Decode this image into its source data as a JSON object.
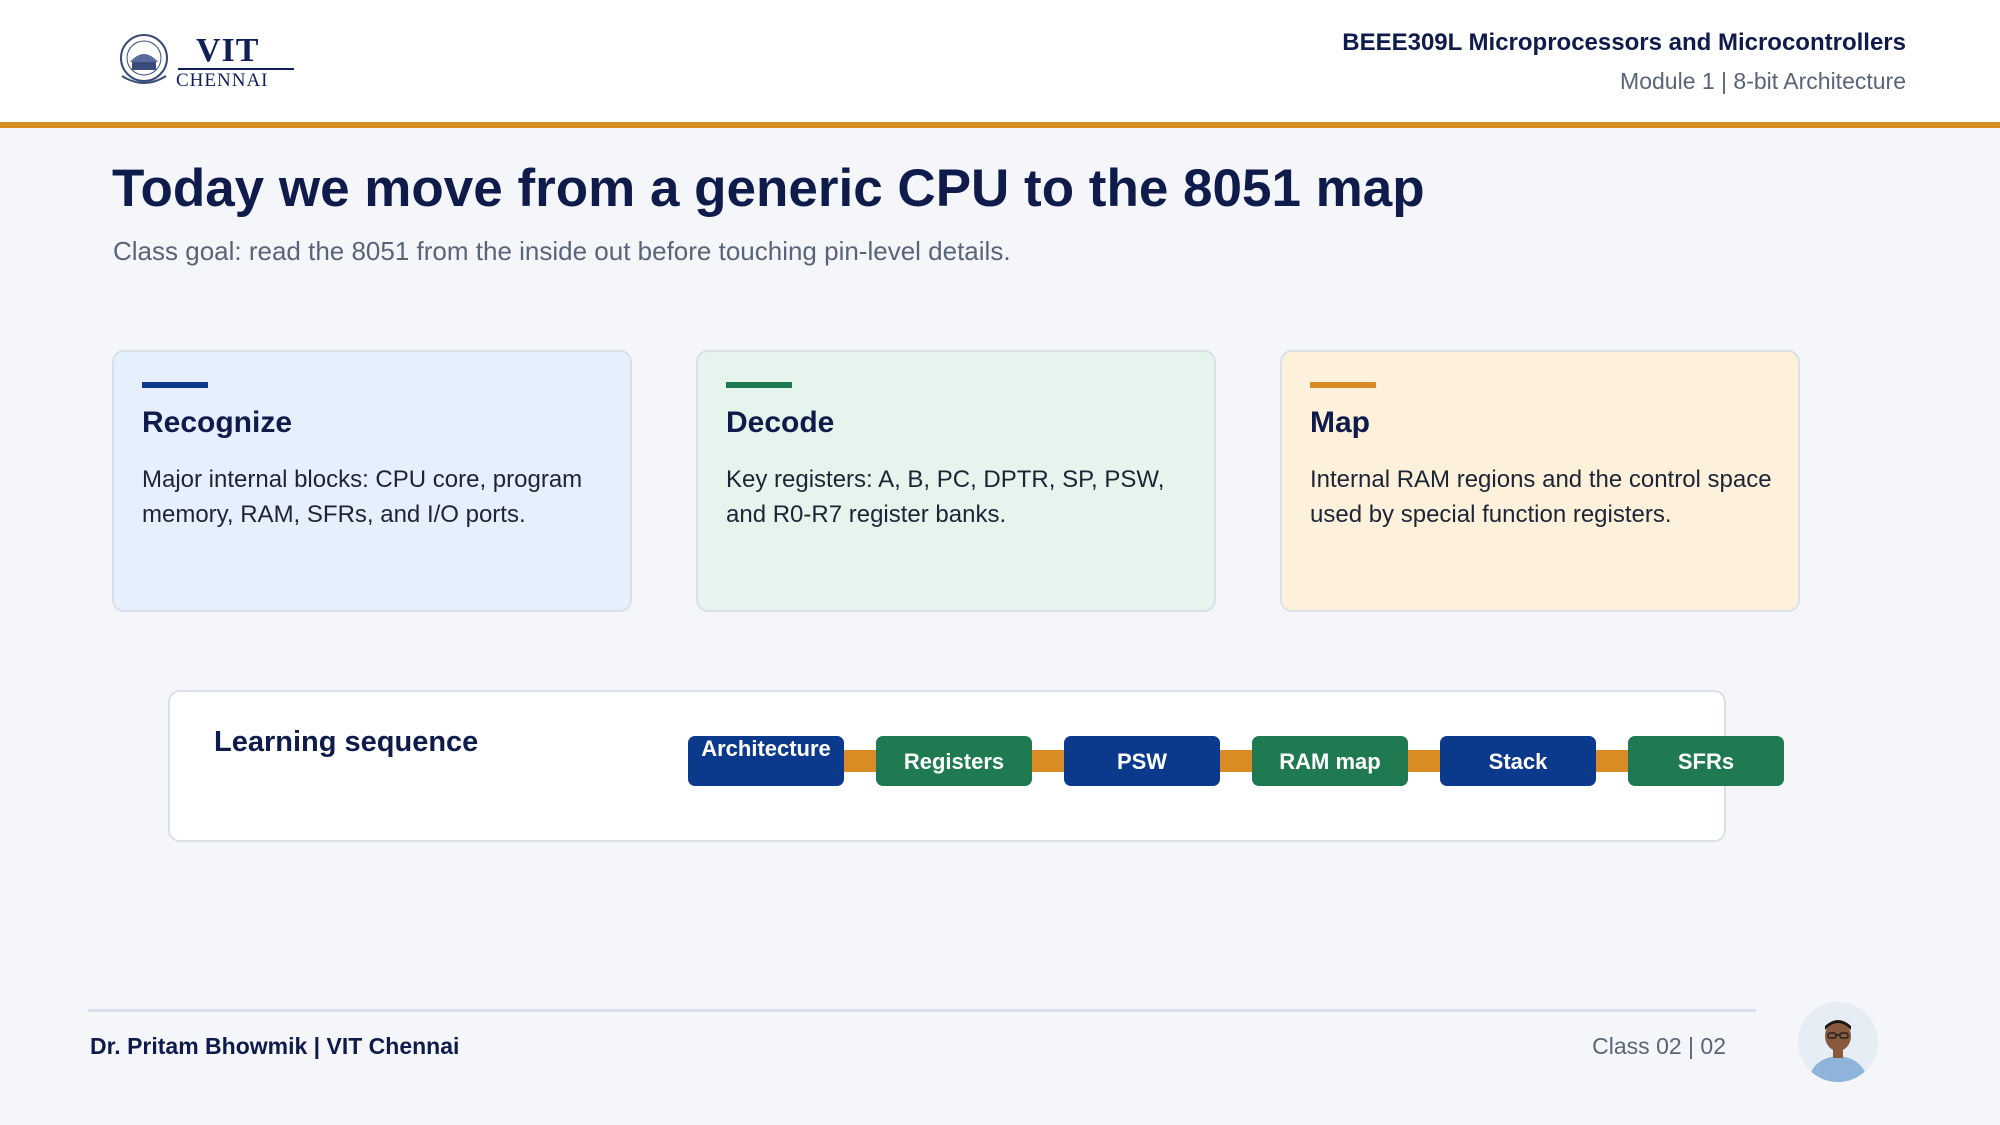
{
  "header": {
    "logo": {
      "word": "VIT",
      "sub": "CHENNAI",
      "seal_icon": "vit-seal-icon"
    },
    "course_title": "BEEE309L Microprocessors and Microcontrollers",
    "module": "Module 1 | 8-bit Architecture"
  },
  "slide": {
    "title": "Today we move from a generic CPU to the 8051 map",
    "subtitle": "Class goal: read the 8051 from the inside out before touching pin-level details."
  },
  "cards": [
    {
      "title": "Recognize",
      "text": "Major internal blocks: CPU core, program memory, RAM, SFRs, and I/O ports.",
      "accent": "#0b3a8c",
      "bg": "#e6effc"
    },
    {
      "title": "Decode",
      "text": "Key registers: A, B, PC, DPTR, SP, PSW, and R0-R7 register banks.",
      "accent": "#1f7a52",
      "bg": "#e5f4ec"
    },
    {
      "title": "Map",
      "text": "Internal RAM regions and the control space used by special function registers.",
      "accent": "#d98c24",
      "bg": "#fdf1dc"
    }
  ],
  "sequence": {
    "label": "Learning sequence",
    "steps": [
      {
        "label": "Architecture",
        "color": "#0b3a8c"
      },
      {
        "label": "Registers",
        "color": "#1f7a52"
      },
      {
        "label": "PSW",
        "color": "#0b3a8c"
      },
      {
        "label": "RAM map",
        "color": "#1f7a52"
      },
      {
        "label": "Stack",
        "color": "#0b3a8c"
      },
      {
        "label": "SFRs",
        "color": "#1f7a52"
      }
    ],
    "connector_color": "#d98c24"
  },
  "footer": {
    "author": "Dr. Pritam Bhowmik | VIT Chennai",
    "class_page": "Class 02  |  02",
    "avatar_icon": "presenter-avatar-icon"
  }
}
